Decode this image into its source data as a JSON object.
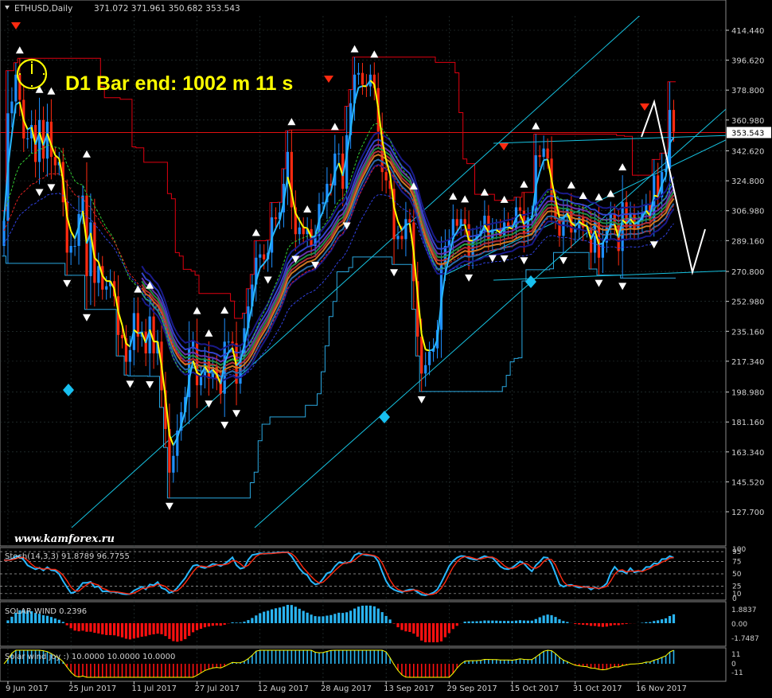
{
  "header": {
    "symbol": "ETHUSD,Daily",
    "ohlc": "371.072 371.961 350.682 353.543"
  },
  "timer": {
    "label": "D1 Bar end: 1002 m 11 s"
  },
  "watermark": "www.kamforex.ru",
  "colors": {
    "bull": "#1e90ff",
    "bear": "#ff2a10",
    "grid": "#2e3d3d",
    "axis": "#d0d0d0",
    "price_line": "#e01010",
    "cyan": "#16c2e0",
    "yellow": "#ffff00"
  },
  "chart_data": [
    {
      "type": "candlestick",
      "price_labels": [
        "414.440",
        "396.620",
        "378.800",
        "360.980",
        "342.620",
        "324.800",
        "306.980",
        "289.160",
        "270.800",
        "252.980",
        "235.160",
        "217.340",
        "198.980",
        "181.160",
        "163.340",
        "145.520",
        "127.700"
      ],
      "ylim": [
        127.7,
        414.44
      ],
      "current_price": "353.543",
      "date_labels": [
        "9 Jun 2017",
        "25 Jun 2017",
        "11 Jul 2017",
        "27 Jul 2017",
        "12 Aug 2017",
        "28 Aug 2017",
        "13 Sep 2017",
        "29 Sep 2017",
        "15 Oct 2017",
        "31 Oct 2017",
        "16 Nov 2017"
      ],
      "start_date": "2017-06-08",
      "close": [
        301,
        365,
        372,
        388,
        373,
        350,
        350,
        358,
        336,
        361,
        338,
        360,
        339,
        334,
        336,
        312,
        282,
        286,
        286,
        305,
        316,
        268,
        300,
        264,
        274,
        260,
        262,
        265,
        256,
        233,
        231,
        217,
        224,
        246,
        232,
        235,
        222,
        244,
        222,
        229,
        200,
        177,
        151,
        161,
        176,
        187,
        196,
        225,
        229,
        203,
        208,
        219,
        207,
        214,
        207,
        198,
        229,
        229,
        228,
        204,
        220,
        237,
        250,
        263,
        279,
        281,
        278,
        282,
        303,
        302,
        306,
        323,
        342,
        309,
        293,
        297,
        293,
        296,
        286,
        292,
        311,
        312,
        323,
        322,
        341,
        341,
        320,
        352,
        371,
        388,
        389,
        382,
        381,
        388,
        380,
        354,
        330,
        325,
        320,
        290,
        292,
        290,
        302,
        300,
        265,
        232,
        210,
        215,
        223,
        225,
        236,
        275,
        286,
        290,
        302,
        298,
        302,
        299,
        280,
        289,
        292,
        295,
        304,
        290,
        296,
        296,
        292,
        300,
        297,
        296,
        309,
        307,
        293,
        303,
        304,
        340,
        339,
        344,
        338,
        313,
        302,
        292,
        303,
        308,
        294,
        296,
        303,
        297,
        297,
        282,
        300,
        279,
        288,
        297,
        305,
        299,
        283,
        312,
        297,
        305,
        296,
        301,
        306,
        311,
        301,
        328,
        315,
        330,
        332,
        367,
        354
      ],
      "stoch_levels": [
        "100",
        "95",
        "75",
        "50",
        "25",
        "10",
        "0"
      ],
      "series": [
        {
          "name": "Stoch(14,3,3) 91.8789 96.7755",
          "values": []
        },
        {
          "name": "SOLAR WIND 0.2396",
          "values": []
        },
        {
          "name": "Solar wind joy :) 10.0000 10.0000 10.0000",
          "values": []
        }
      ],
      "solar_levels": [
        "1.8837",
        "0.00",
        "-1.7487"
      ],
      "joy_levels": [
        "11",
        "0",
        "-11"
      ]
    }
  ]
}
